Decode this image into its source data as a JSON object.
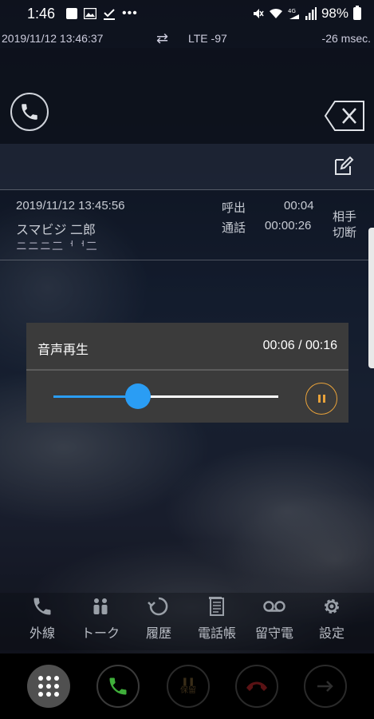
{
  "status_bar": {
    "time": "1:46",
    "battery": "98%",
    "icons": [
      "gallery-icon",
      "image-icon",
      "download-icon",
      "more-icon",
      "mute-icon",
      "wifi-icon",
      "4g-signal-icon",
      "signal-icon",
      "battery-icon"
    ]
  },
  "info_bar": {
    "datetime": "2019/11/12 13:46:37",
    "network": "LTE -97",
    "latency": "-26 msec."
  },
  "history": {
    "date": "2019/11/12 13:45:56",
    "name": "スマビジ 二郎",
    "number": "ニニニ二ᅥᅥ二",
    "ring_label": "呼出",
    "ring_time": "00:04",
    "talk_label": "通話",
    "talk_time": "00:00:26",
    "end_reason": "相手切断"
  },
  "player": {
    "title": "音声再生",
    "time": "00:06 / 00:16",
    "progress": 0.375
  },
  "tabs": [
    {
      "label": "外線",
      "icon": "phone-icon"
    },
    {
      "label": "トーク",
      "icon": "talk-icon"
    },
    {
      "label": "履歴",
      "icon": "history-icon"
    },
    {
      "label": "電話帳",
      "icon": "phonebook-icon"
    },
    {
      "label": "留守電",
      "icon": "voicemail-icon"
    },
    {
      "label": "設定",
      "icon": "gear-icon"
    }
  ],
  "bottom": {
    "hold_label": "保留",
    "colors": {
      "call": "#3fae3a",
      "hangup": "#c0262c",
      "accent": "#2a9df4",
      "pause": "#e8a23a"
    }
  }
}
